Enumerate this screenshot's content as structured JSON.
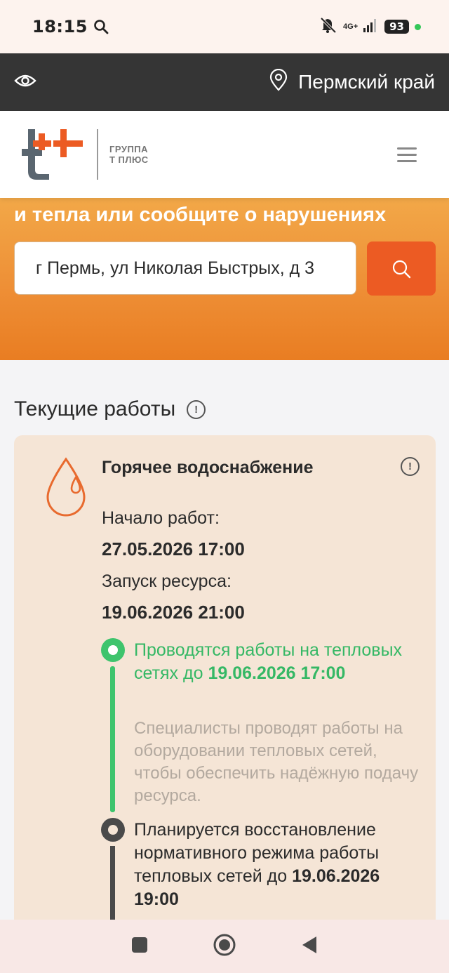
{
  "status_bar": {
    "time": "18:15",
    "network": "4G+",
    "battery": "93"
  },
  "top_bar": {
    "region": "Пермский край"
  },
  "header": {
    "logo_line1": "ГРУППА",
    "logo_line2": "Т ПЛЮС"
  },
  "hero": {
    "headline": "и тепла или сообщите о нарушениях",
    "address_value": "г Пермь, ул Николая Быстрых, д 3"
  },
  "section": {
    "title": "Текущие работы"
  },
  "card": {
    "title": "Горячее водоснабжение",
    "start_label": "Начало работ:",
    "start_value": "27.05.2026 17:00",
    "launch_label": "Запуск ресурса:",
    "launch_value": "19.06.2026 21:00",
    "steps": [
      {
        "text": "Проводятся работы на тепловых сетях до ",
        "date": "19.06.2026 17:00",
        "description": "Специалисты проводят работы на оборудовании тепловых сетей, чтобы обеспечить надёжную подачу ресурса."
      },
      {
        "text": "Планируется восстановление нормативного режима работы тепловых сетей до ",
        "date": "19.06.2026 19:00"
      }
    ]
  },
  "colors": {
    "accent_orange": "#ec5b23",
    "hero_orange": "#ee8f36",
    "active_green": "#3ec46d",
    "card_bg": "#f5e5d6",
    "top_bar": "#353535"
  },
  "icons": [
    "search-icon",
    "mute-icon",
    "signal-icon",
    "eye-icon",
    "location-pin-icon",
    "menu-icon",
    "water-drop-icon",
    "info-icon",
    "nav-recent-icon",
    "nav-home-icon",
    "nav-back-icon"
  ]
}
